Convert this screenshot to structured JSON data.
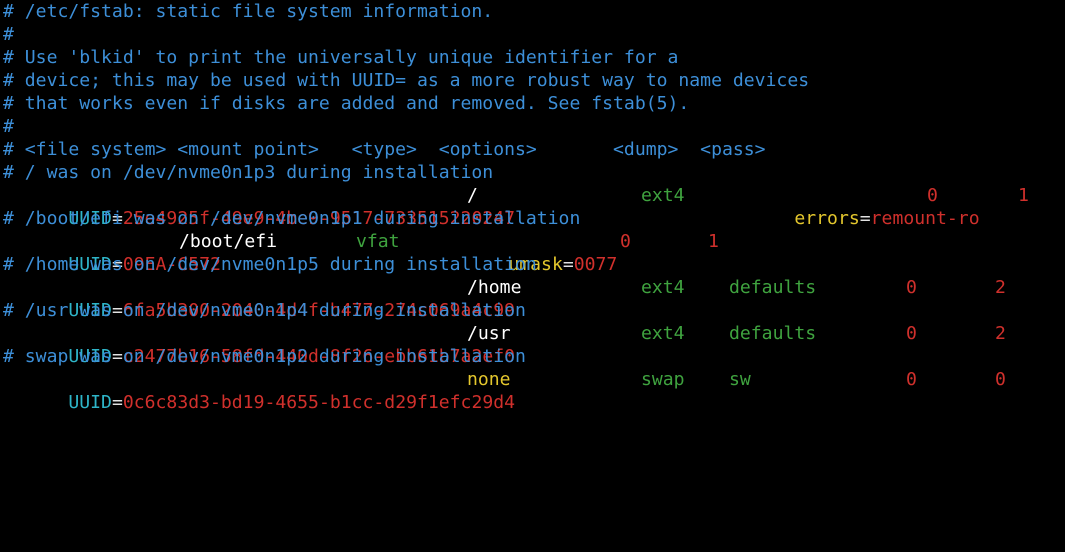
{
  "comments": {
    "line1": "# /etc/fstab: static file system information.",
    "line2": "#",
    "line3": "# Use 'blkid' to print the universally unique identifier for a",
    "line4": "# device; this may be used with UUID= as a more robust way to name devices",
    "line5": "# that works even if disks are added and removed. See fstab(5).",
    "line6": "#",
    "header": "# <file system> <mount point>   <type>  <options>       <dump>  <pass>"
  },
  "entries": [
    {
      "comment": "# / was on /dev/nvme0n1p3 during installation",
      "key": "UUID",
      "eq": "=",
      "uuid": "25e4925f-49e9-4be9-9517-733515220247",
      "mount": "/",
      "type": "ext4",
      "opt_kw": "errors",
      "opt_eq": "=",
      "opt_val": "remount-ro",
      "dump": "0",
      "pass": "1"
    },
    {
      "comment": "# /boot/efi was on /dev/nvme0n1p1 during installation",
      "key": "UUID",
      "eq": "=",
      "uuid": "09EA-C572",
      "mount": "/boot/efi",
      "type": "vfat",
      "opt_kw": "umask",
      "opt_eq": "=",
      "opt_val": "0077",
      "dump": "0",
      "pass": "1"
    },
    {
      "comment": "# /home was on /dev/nvme0n1p5 during installation",
      "key": "UUID",
      "eq": "=",
      "uuid": "6fa5b300-2040-4d4f-b477-274c069a4c99",
      "mount": "/home",
      "type": "ext4",
      "options": "defaults",
      "dump": "0",
      "pass": "2"
    },
    {
      "comment": "# /usr was on /dev/nvme0n1p4 during installation",
      "key": "UUID",
      "eq": "=",
      "uuid": "c2477b16-58fd-440d-8f26-ebb61b7a2ef0",
      "mount": "/usr",
      "type": "ext4",
      "options": "defaults",
      "dump": "0",
      "pass": "2"
    },
    {
      "comment": "# swap was on /dev/nvme0n1p2 during installation",
      "key": "UUID",
      "eq": "=",
      "uuid": "0c6c83d3-bd19-4655-b1cc-d29f1efc29d4",
      "mount": "none",
      "type": "swap",
      "options": "sw",
      "dump": "0",
      "pass": "0"
    }
  ],
  "colors": {
    "background": "#000000",
    "comment": "#3d8fd8",
    "key": "#2eb5c8",
    "uuid": "#d0302c",
    "type": "#3fa33f",
    "keyword": "#e4c72d"
  }
}
